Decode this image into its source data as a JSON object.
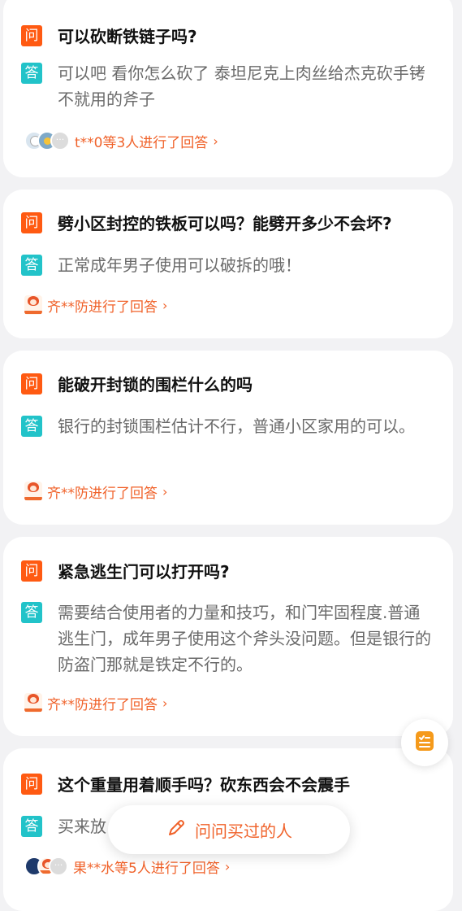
{
  "qa_list": [
    {
      "question_icon": "问",
      "question": "可以砍断铁链子吗?",
      "answer_icon": "答",
      "answer": "可以吧 看你怎么砍了 泰坦尼克上肉丝给杰克砍手铐不就用的斧子",
      "meta": "t**0等3人进行了回答",
      "chevron": "›"
    },
    {
      "question_icon": "问",
      "question": "劈小区封控的铁板可以吗？能劈开多少不会坏?",
      "answer_icon": "答",
      "answer": "正常成年男子使用可以破拆的哦！",
      "meta": "齐**防进行了回答",
      "chevron": "›"
    },
    {
      "question_icon": "问",
      "question": "能破开封锁的围栏什么的吗",
      "answer_icon": "答",
      "answer": "银行的封锁围栏估计不行，普通小区家用的可以。",
      "meta": "齐**防进行了回答",
      "chevron": "›"
    },
    {
      "question_icon": "问",
      "question": "紧急逃生门可以打开吗?",
      "answer_icon": "答",
      "answer": "需要结合使用者的力量和技巧，和门牢固程度.普通逃生门，成年男子使用这个斧头没问题。但是银行的防盗门那就是铁定不行的。",
      "meta": "齐**防进行了回答",
      "chevron": "›"
    },
    {
      "question_icon": "问",
      "question": "这个重量用着顺手吗？砍东西会不会震手",
      "answer_icon": "答",
      "answer": "买来放",
      "meta": "果**水等5人进行了回答",
      "chevron": "›"
    }
  ],
  "more_dots": "···",
  "ask_button": {
    "label": "问问买过的人",
    "icon": "pencil-icon"
  },
  "fab": {
    "icon": "checklist-icon"
  },
  "colors": {
    "accent": "#f0622a",
    "question_badge": "#ff5a12",
    "answer_badge": "#22c3c9"
  }
}
